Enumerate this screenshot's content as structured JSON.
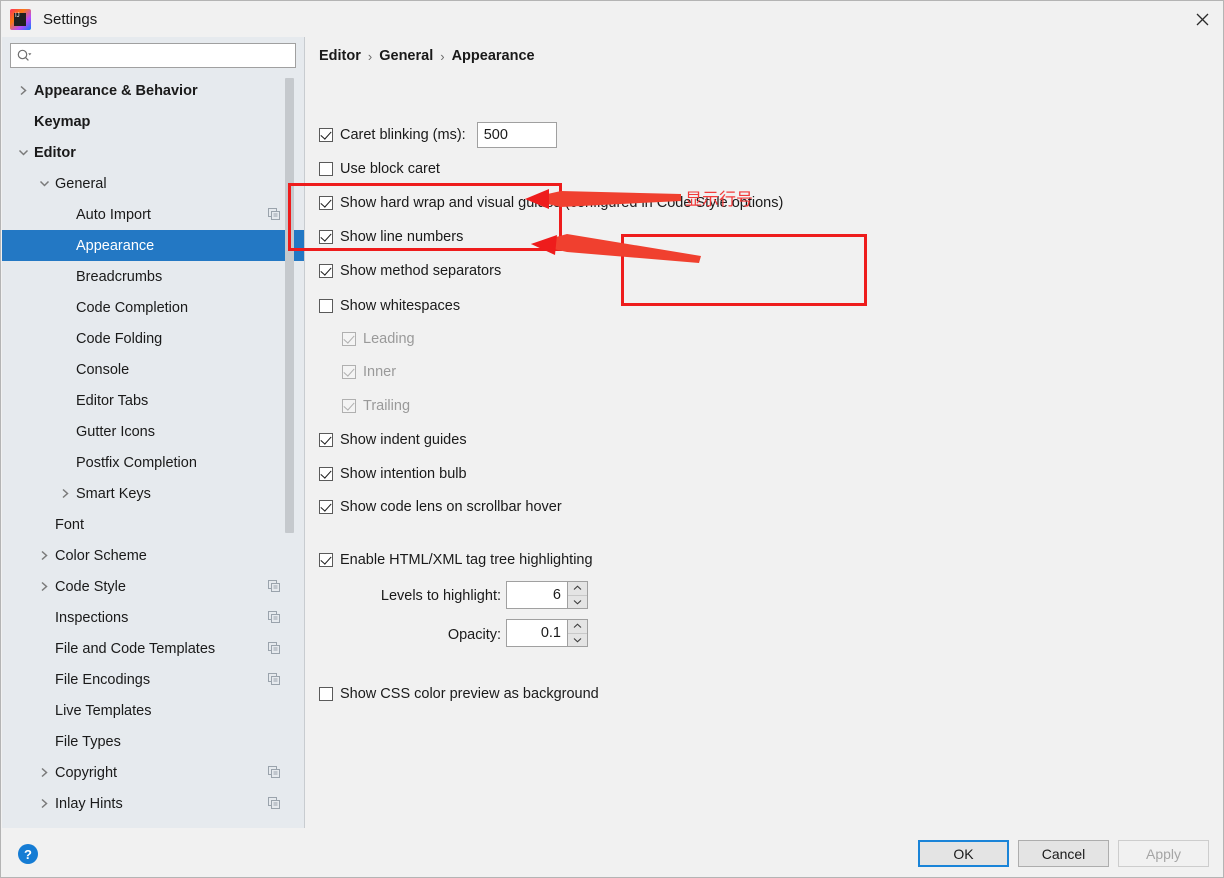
{
  "window": {
    "title": "Settings",
    "logo_icon": "intellij-idea-logo",
    "close_icon": "close-icon"
  },
  "sidebar": {
    "search": {
      "placeholder": "",
      "value": "",
      "icon": "search-icon"
    },
    "items": [
      {
        "label": "Appearance & Behavior",
        "level": 0,
        "chevron": "chevron-right-icon",
        "bold": true,
        "selected": false,
        "copy_icon": false
      },
      {
        "label": "Keymap",
        "level": 0,
        "chevron": "",
        "bold": true,
        "selected": false,
        "copy_icon": false
      },
      {
        "label": "Editor",
        "level": 0,
        "chevron": "chevron-down-icon",
        "bold": true,
        "selected": false,
        "copy_icon": false
      },
      {
        "label": "General",
        "level": 1,
        "chevron": "chevron-down-icon",
        "bold": false,
        "selected": false,
        "copy_icon": false
      },
      {
        "label": "Auto Import",
        "level": 2,
        "chevron": "",
        "bold": false,
        "selected": false,
        "copy_icon": true
      },
      {
        "label": "Appearance",
        "level": 2,
        "chevron": "",
        "bold": false,
        "selected": true,
        "copy_icon": false
      },
      {
        "label": "Breadcrumbs",
        "level": 2,
        "chevron": "",
        "bold": false,
        "selected": false,
        "copy_icon": false
      },
      {
        "label": "Code Completion",
        "level": 2,
        "chevron": "",
        "bold": false,
        "selected": false,
        "copy_icon": false
      },
      {
        "label": "Code Folding",
        "level": 2,
        "chevron": "",
        "bold": false,
        "selected": false,
        "copy_icon": false
      },
      {
        "label": "Console",
        "level": 2,
        "chevron": "",
        "bold": false,
        "selected": false,
        "copy_icon": false
      },
      {
        "label": "Editor Tabs",
        "level": 2,
        "chevron": "",
        "bold": false,
        "selected": false,
        "copy_icon": false
      },
      {
        "label": "Gutter Icons",
        "level": 2,
        "chevron": "",
        "bold": false,
        "selected": false,
        "copy_icon": false
      },
      {
        "label": "Postfix Completion",
        "level": 2,
        "chevron": "",
        "bold": false,
        "selected": false,
        "copy_icon": false
      },
      {
        "label": "Smart Keys",
        "level": 2,
        "chevron": "chevron-right-icon",
        "bold": false,
        "selected": false,
        "copy_icon": false
      },
      {
        "label": "Font",
        "level": 1,
        "chevron": "",
        "bold": false,
        "selected": false,
        "copy_icon": false
      },
      {
        "label": "Color Scheme",
        "level": 1,
        "chevron": "chevron-right-icon",
        "bold": false,
        "selected": false,
        "copy_icon": false
      },
      {
        "label": "Code Style",
        "level": 1,
        "chevron": "chevron-right-icon",
        "bold": false,
        "selected": false,
        "copy_icon": true
      },
      {
        "label": "Inspections",
        "level": 1,
        "chevron": "",
        "bold": false,
        "selected": false,
        "copy_icon": true
      },
      {
        "label": "File and Code Templates",
        "level": 1,
        "chevron": "",
        "bold": false,
        "selected": false,
        "copy_icon": true
      },
      {
        "label": "File Encodings",
        "level": 1,
        "chevron": "",
        "bold": false,
        "selected": false,
        "copy_icon": true
      },
      {
        "label": "Live Templates",
        "level": 1,
        "chevron": "",
        "bold": false,
        "selected": false,
        "copy_icon": false
      },
      {
        "label": "File Types",
        "level": 1,
        "chevron": "",
        "bold": false,
        "selected": false,
        "copy_icon": false
      },
      {
        "label": "Copyright",
        "level": 1,
        "chevron": "chevron-right-icon",
        "bold": false,
        "selected": false,
        "copy_icon": true
      },
      {
        "label": "Inlay Hints",
        "level": 1,
        "chevron": "chevron-right-icon",
        "bold": false,
        "selected": false,
        "copy_icon": true
      }
    ]
  },
  "main": {
    "breadcrumb": [
      "Editor",
      "General",
      "Appearance"
    ],
    "breadcrumb_separator": "›",
    "options": {
      "caret_blinking_label": "Caret blinking (ms):",
      "caret_blinking_value": "500",
      "use_block_caret": "Use block caret",
      "show_hard_wrap": "Show hard wrap and visual guides (configured in Code Style options)",
      "show_line_numbers": "Show line numbers",
      "show_method_separators": "Show method separators",
      "show_whitespaces": "Show whitespaces",
      "leading": "Leading",
      "inner": "Inner",
      "trailing": "Trailing",
      "show_indent_guides": "Show indent guides",
      "show_intention_bulb": "Show intention bulb",
      "show_code_lens": "Show code lens on scrollbar hover",
      "enable_html_xml": "Enable HTML/XML tag tree highlighting",
      "levels_label": "Levels to highlight:",
      "levels_value": "6",
      "opacity_label": "Opacity:",
      "opacity_value": "0.1",
      "show_css_preview": "Show CSS color preview as background"
    }
  },
  "annotations": {
    "note_text": "显示行号",
    "color": "#ee1c1c"
  },
  "footer": {
    "help_label": "?",
    "ok_label": "OK",
    "cancel_label": "Cancel",
    "apply_label": "Apply"
  }
}
